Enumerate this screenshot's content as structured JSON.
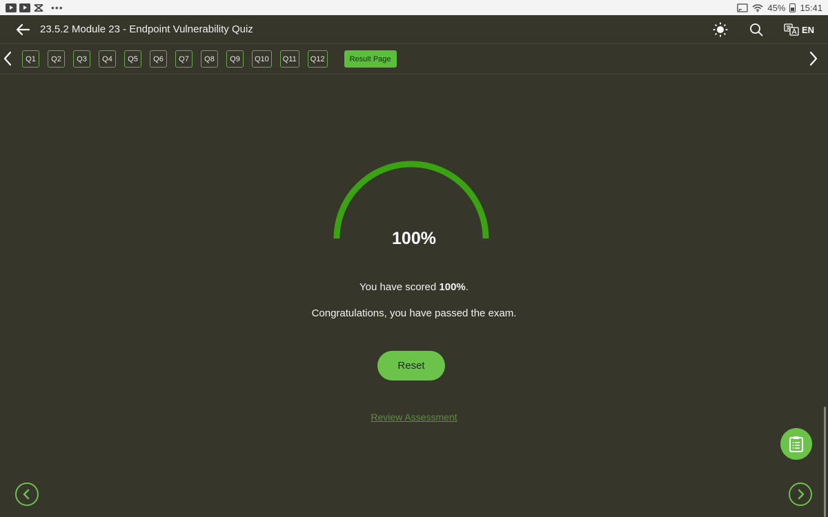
{
  "statusbar": {
    "battery": "45%",
    "time": "15:41"
  },
  "header": {
    "title": "23.5.2 Module 23 - Endpoint Vulnerability Quiz",
    "language": "EN"
  },
  "qnav": {
    "tabs": [
      "Q1",
      "Q2",
      "Q3",
      "Q4",
      "Q5",
      "Q6",
      "Q7",
      "Q8",
      "Q9",
      "Q10",
      "Q11",
      "Q12"
    ],
    "active_tab": "Result Page"
  },
  "result": {
    "score": "100%",
    "score_fraction": 1.0,
    "score_prefix": "You have scored ",
    "score_value": "100%",
    "score_suffix": ".",
    "congrats": "Congratulations, you have passed the exam.",
    "reset_label": "Reset",
    "review_label": "Review Assessment"
  },
  "colors": {
    "accent": "#6cc34a",
    "gauge": "#3aa312",
    "background": "#36362a"
  }
}
